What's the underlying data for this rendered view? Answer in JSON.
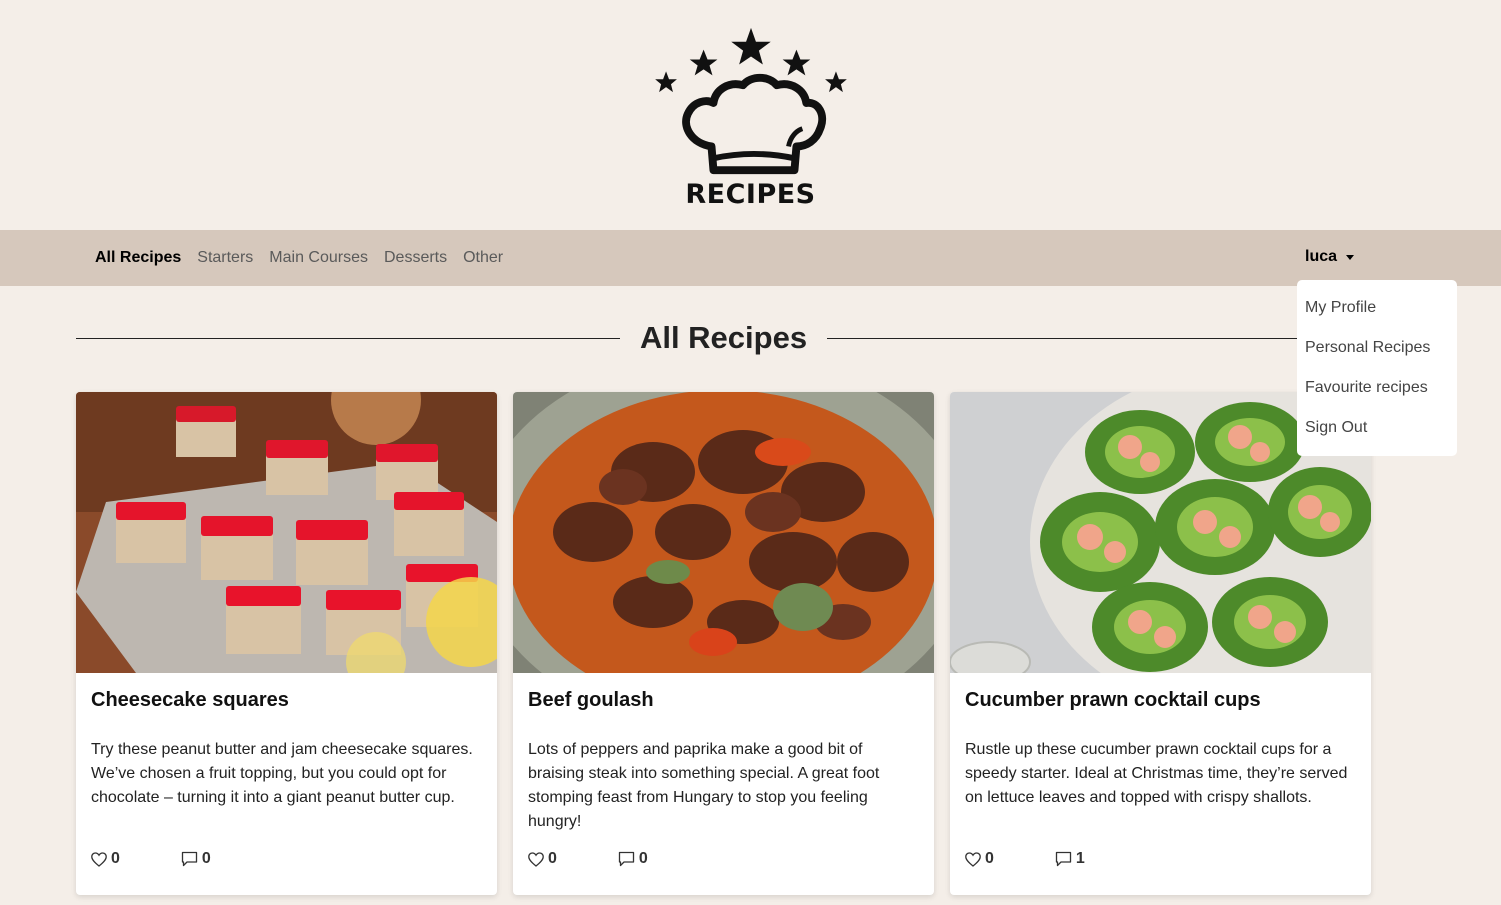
{
  "logo": {
    "text": "RECIPES"
  },
  "nav": {
    "links": [
      {
        "label": "All Recipes",
        "active": true
      },
      {
        "label": "Starters"
      },
      {
        "label": "Main Courses"
      },
      {
        "label": "Desserts"
      },
      {
        "label": "Other"
      }
    ],
    "user": "luca"
  },
  "user_menu": {
    "items": [
      "My Profile",
      "Personal Recipes",
      "Favourite recipes",
      "Sign Out"
    ]
  },
  "main": {
    "title": "All Recipes",
    "cards": [
      {
        "title": "Cheesecake squares",
        "description": "Try these peanut butter and jam cheesecake squares. We’ve chosen a fruit topping, but you could opt for chocolate – turning it into a giant peanut butter cup.",
        "likes": "0",
        "comments": "0"
      },
      {
        "title": "Beef goulash",
        "description": "Lots of peppers and paprika make a good bit of braising steak into something special. A great foot stomping feast from Hungary to stop you feeling hungry!",
        "likes": "0",
        "comments": "0"
      },
      {
        "title": "Cucumber prawn cocktail cups",
        "description": "Rustle up these cucumber prawn cocktail cups for a speedy starter. Ideal at Christmas time, they’re served on lettuce leaves and topped with crispy shallots.",
        "likes": "0",
        "comments": "1"
      }
    ]
  },
  "colors": {
    "page_bg": "#f4eee8",
    "navbar_bg": "#d6c8bc",
    "card_bg": "#ffffff"
  }
}
